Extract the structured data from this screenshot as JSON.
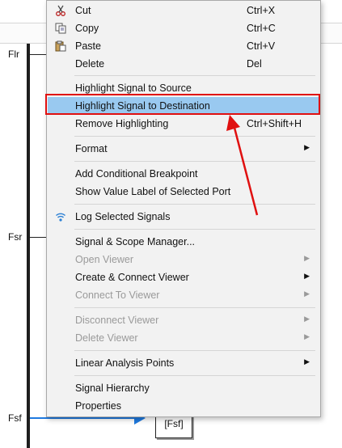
{
  "ports": {
    "flr": "Flr",
    "fsr": "Fsr",
    "fsf": "Fsf"
  },
  "goto_block": "[Fsf]",
  "menu": {
    "items": [
      {
        "label": "Cut",
        "shortcut": "Ctrl+X",
        "icon": "scissors-icon"
      },
      {
        "label": "Copy",
        "shortcut": "Ctrl+C",
        "icon": "copy-icon"
      },
      {
        "label": "Paste",
        "shortcut": "Ctrl+V",
        "icon": "paste-icon"
      },
      {
        "label": "Delete",
        "shortcut": "Del"
      },
      {
        "label": "Highlight Signal to Source"
      },
      {
        "label": "Highlight Signal to Destination",
        "highlighted": true
      },
      {
        "label": "Remove Highlighting",
        "shortcut": "Ctrl+Shift+H"
      },
      {
        "label": "Format",
        "submenu": true
      },
      {
        "label": "Add Conditional Breakpoint"
      },
      {
        "label": "Show Value Label of Selected Port"
      },
      {
        "label": "Log Selected Signals",
        "icon": "wifi-signal-icon"
      },
      {
        "label": "Signal & Scope Manager..."
      },
      {
        "label": "Open Viewer",
        "submenu": true,
        "disabled": true
      },
      {
        "label": "Create & Connect Viewer",
        "submenu": true
      },
      {
        "label": "Connect To Viewer",
        "submenu": true,
        "disabled": true
      },
      {
        "label": "Disconnect Viewer",
        "submenu": true,
        "disabled": true
      },
      {
        "label": "Delete Viewer",
        "submenu": true,
        "disabled": true
      },
      {
        "label": "Linear Analysis Points",
        "submenu": true
      },
      {
        "label": "Signal Hierarchy"
      },
      {
        "label": "Properties"
      }
    ]
  },
  "colors": {
    "highlight_row": "#99c9f0",
    "annotation_red": "#e01010",
    "signal_blue": "#1f7ae0"
  }
}
